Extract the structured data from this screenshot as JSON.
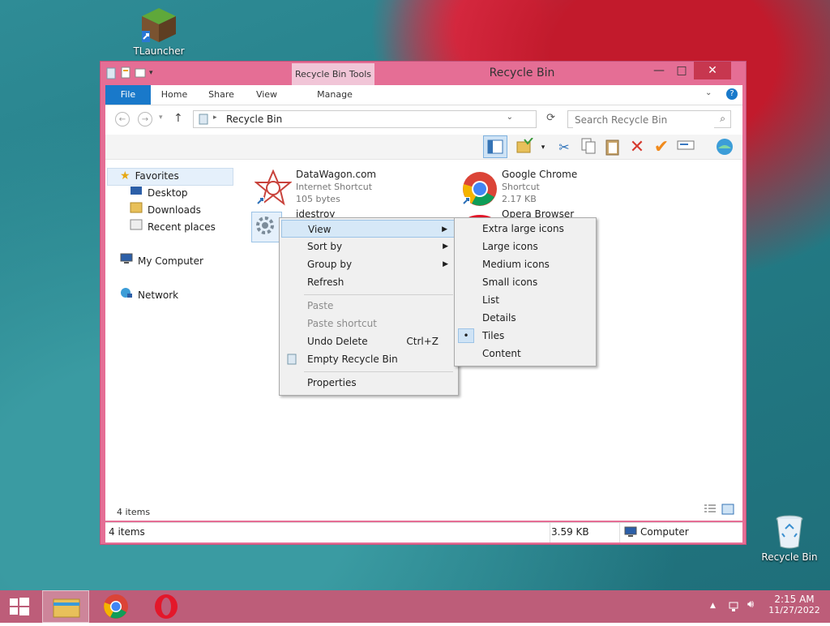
{
  "desktop": {
    "icons": [
      {
        "label": "TLauncher"
      },
      {
        "label": "Recycle Bin"
      }
    ]
  },
  "window": {
    "title": "Recycle Bin",
    "contextual_tab": "Recycle Bin Tools",
    "ribbon_tabs": [
      "File",
      "Home",
      "Share",
      "View",
      "Manage"
    ],
    "address": "Recycle Bin",
    "search_placeholder": "Search Recycle Bin",
    "nav": {
      "favorites": "Favorites",
      "desktop": "Desktop",
      "downloads": "Downloads",
      "recent": "Recent places",
      "computer": "My Computer",
      "network": "Network"
    },
    "files": [
      {
        "name": "DataWagon.com",
        "type": "Internet Shortcut",
        "size": "105 bytes"
      },
      {
        "name": "Google Chrome",
        "type": "Shortcut",
        "size": "2.17 KB"
      },
      {
        "name": "idestroy",
        "type": "",
        "size": ""
      },
      {
        "name": "Opera Browser",
        "type": "",
        "size": ""
      }
    ],
    "item_count": "4 items",
    "status": {
      "items": "4 items",
      "size": "3.59 KB",
      "location": "Computer"
    }
  },
  "context_menu": {
    "items": [
      "View",
      "Sort by",
      "Group by",
      "Refresh",
      "Paste",
      "Paste shortcut",
      "Undo Delete",
      "Empty Recycle Bin",
      "Properties"
    ],
    "undo_shortcut": "Ctrl+Z"
  },
  "view_submenu": {
    "items": [
      "Extra large icons",
      "Large icons",
      "Medium icons",
      "Small icons",
      "List",
      "Details",
      "Tiles",
      "Content"
    ],
    "selected": "Tiles"
  },
  "taskbar": {
    "time": "2:15 AM",
    "date": "11/27/2022"
  },
  "colors": {
    "window_frame": "#e56e95",
    "taskbar": "#bd5d79",
    "file_tab": "#1979ca",
    "menu_highlight": "#d6e8f7"
  }
}
